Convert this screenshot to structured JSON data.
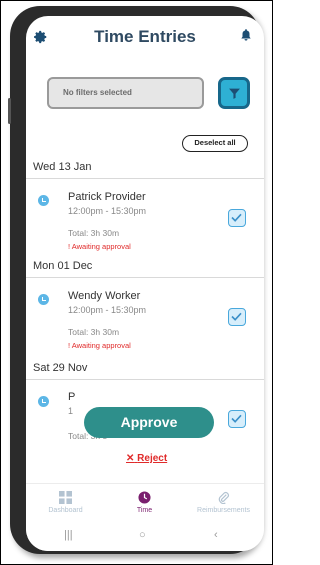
{
  "header": {
    "title": "Time Entries",
    "settings_icon": "gear-icon",
    "notifications_icon": "bell-icon"
  },
  "filter": {
    "text": "No filters selected",
    "button_icon": "filter-icon"
  },
  "deselect_label": "Deselect all",
  "sections": [
    {
      "date": "Wed 13 Jan",
      "name": "Patrick Provider",
      "time": "12:00pm - 15:30pm",
      "total": "Total: 3h 30m",
      "status": "! Awaiting approval",
      "checked": true
    },
    {
      "date": "Mon 01 Dec",
      "name": "Wendy Worker",
      "time": "12:00pm - 15:30pm",
      "total": "Total: 3h 30m",
      "status": "! Awaiting approval",
      "checked": true
    },
    {
      "date": "Sat 29 Nov",
      "name": "P",
      "time": "1",
      "total": "Total: 3h 3",
      "status": "",
      "checked": true
    }
  ],
  "actions": {
    "approve": "Approve",
    "reject": "Reject",
    "reject_symbol": "✕"
  },
  "nav": [
    {
      "label": "Dashboard",
      "icon": "dashboard-icon",
      "active": false
    },
    {
      "label": "Time",
      "icon": "clock-icon",
      "active": true
    },
    {
      "label": "Reimbursements",
      "icon": "paperclip-icon",
      "active": false
    }
  ],
  "system_nav": {
    "recent": "|||",
    "home": "○",
    "back": "‹"
  },
  "colors": {
    "accent": "#2eb0d4",
    "approve": "#2e8f8b",
    "warning": "#e02a2a",
    "active_nav": "#7a1f6e",
    "title": "#2f4a62"
  }
}
